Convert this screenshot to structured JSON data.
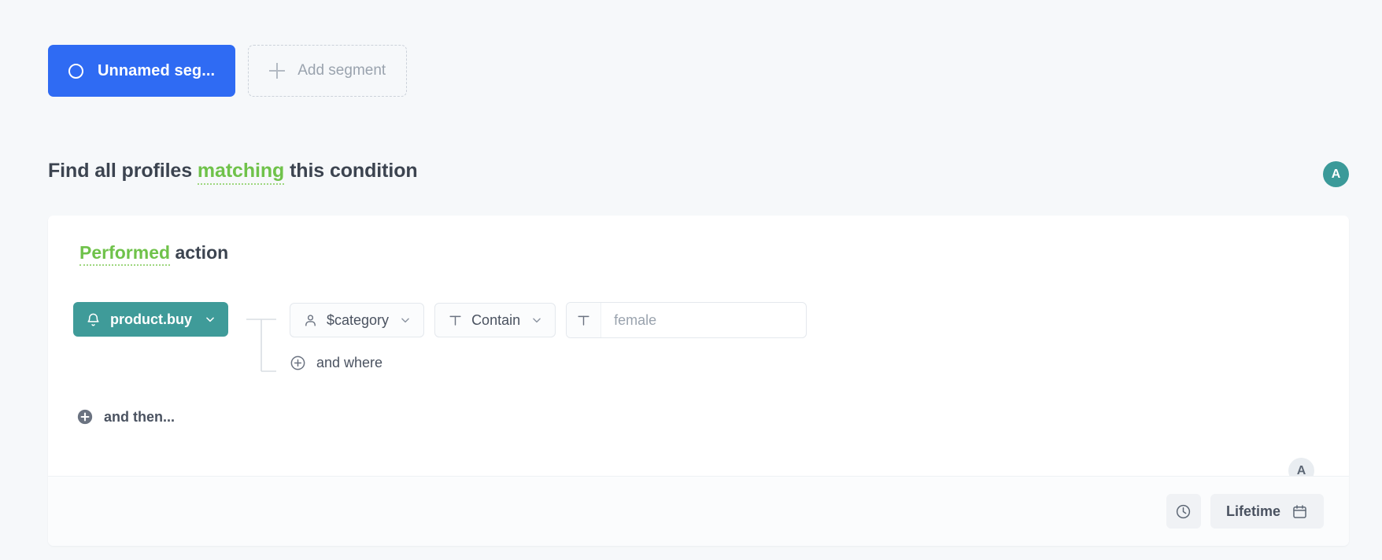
{
  "segments": {
    "active_tab": {
      "label": "Unnamed seg...",
      "icon": "circle-icon",
      "color": "#2f6bf3"
    },
    "add_label": "Add segment",
    "add_icon": "plus-icon"
  },
  "headline": {
    "prefix": "Find all profiles ",
    "keyword": "matching",
    "suffix": " this condition",
    "keyword_color": "#6fc24a"
  },
  "top_avatar": {
    "initial": "A",
    "color": "#3b9a99"
  },
  "condition_card": {
    "avatar": {
      "initial": "A",
      "color": "#e9edf1"
    },
    "title": {
      "keyword": "Performed",
      "rest": "action"
    },
    "event_chip": {
      "label": "product.buy",
      "icon": "bell-icon",
      "chevron": "chevron-down-icon",
      "color": "#3f9b99"
    },
    "filters": [
      {
        "property_label": "$category",
        "property_icon": "user-icon",
        "operator_label": "Contain",
        "operator_icon": "text-type-icon",
        "value": "",
        "value_placeholder": "female",
        "value_icon": "text-type-icon"
      }
    ],
    "and_where_label": "and where",
    "and_where_icon": "circle-plus-outline-icon",
    "and_then_label": "and then...",
    "and_then_icon": "circle-plus-filled-icon",
    "footer": {
      "history_icon": "clock-icon",
      "timeframe_label": "Lifetime",
      "timeframe_icon": "calendar-icon"
    }
  }
}
